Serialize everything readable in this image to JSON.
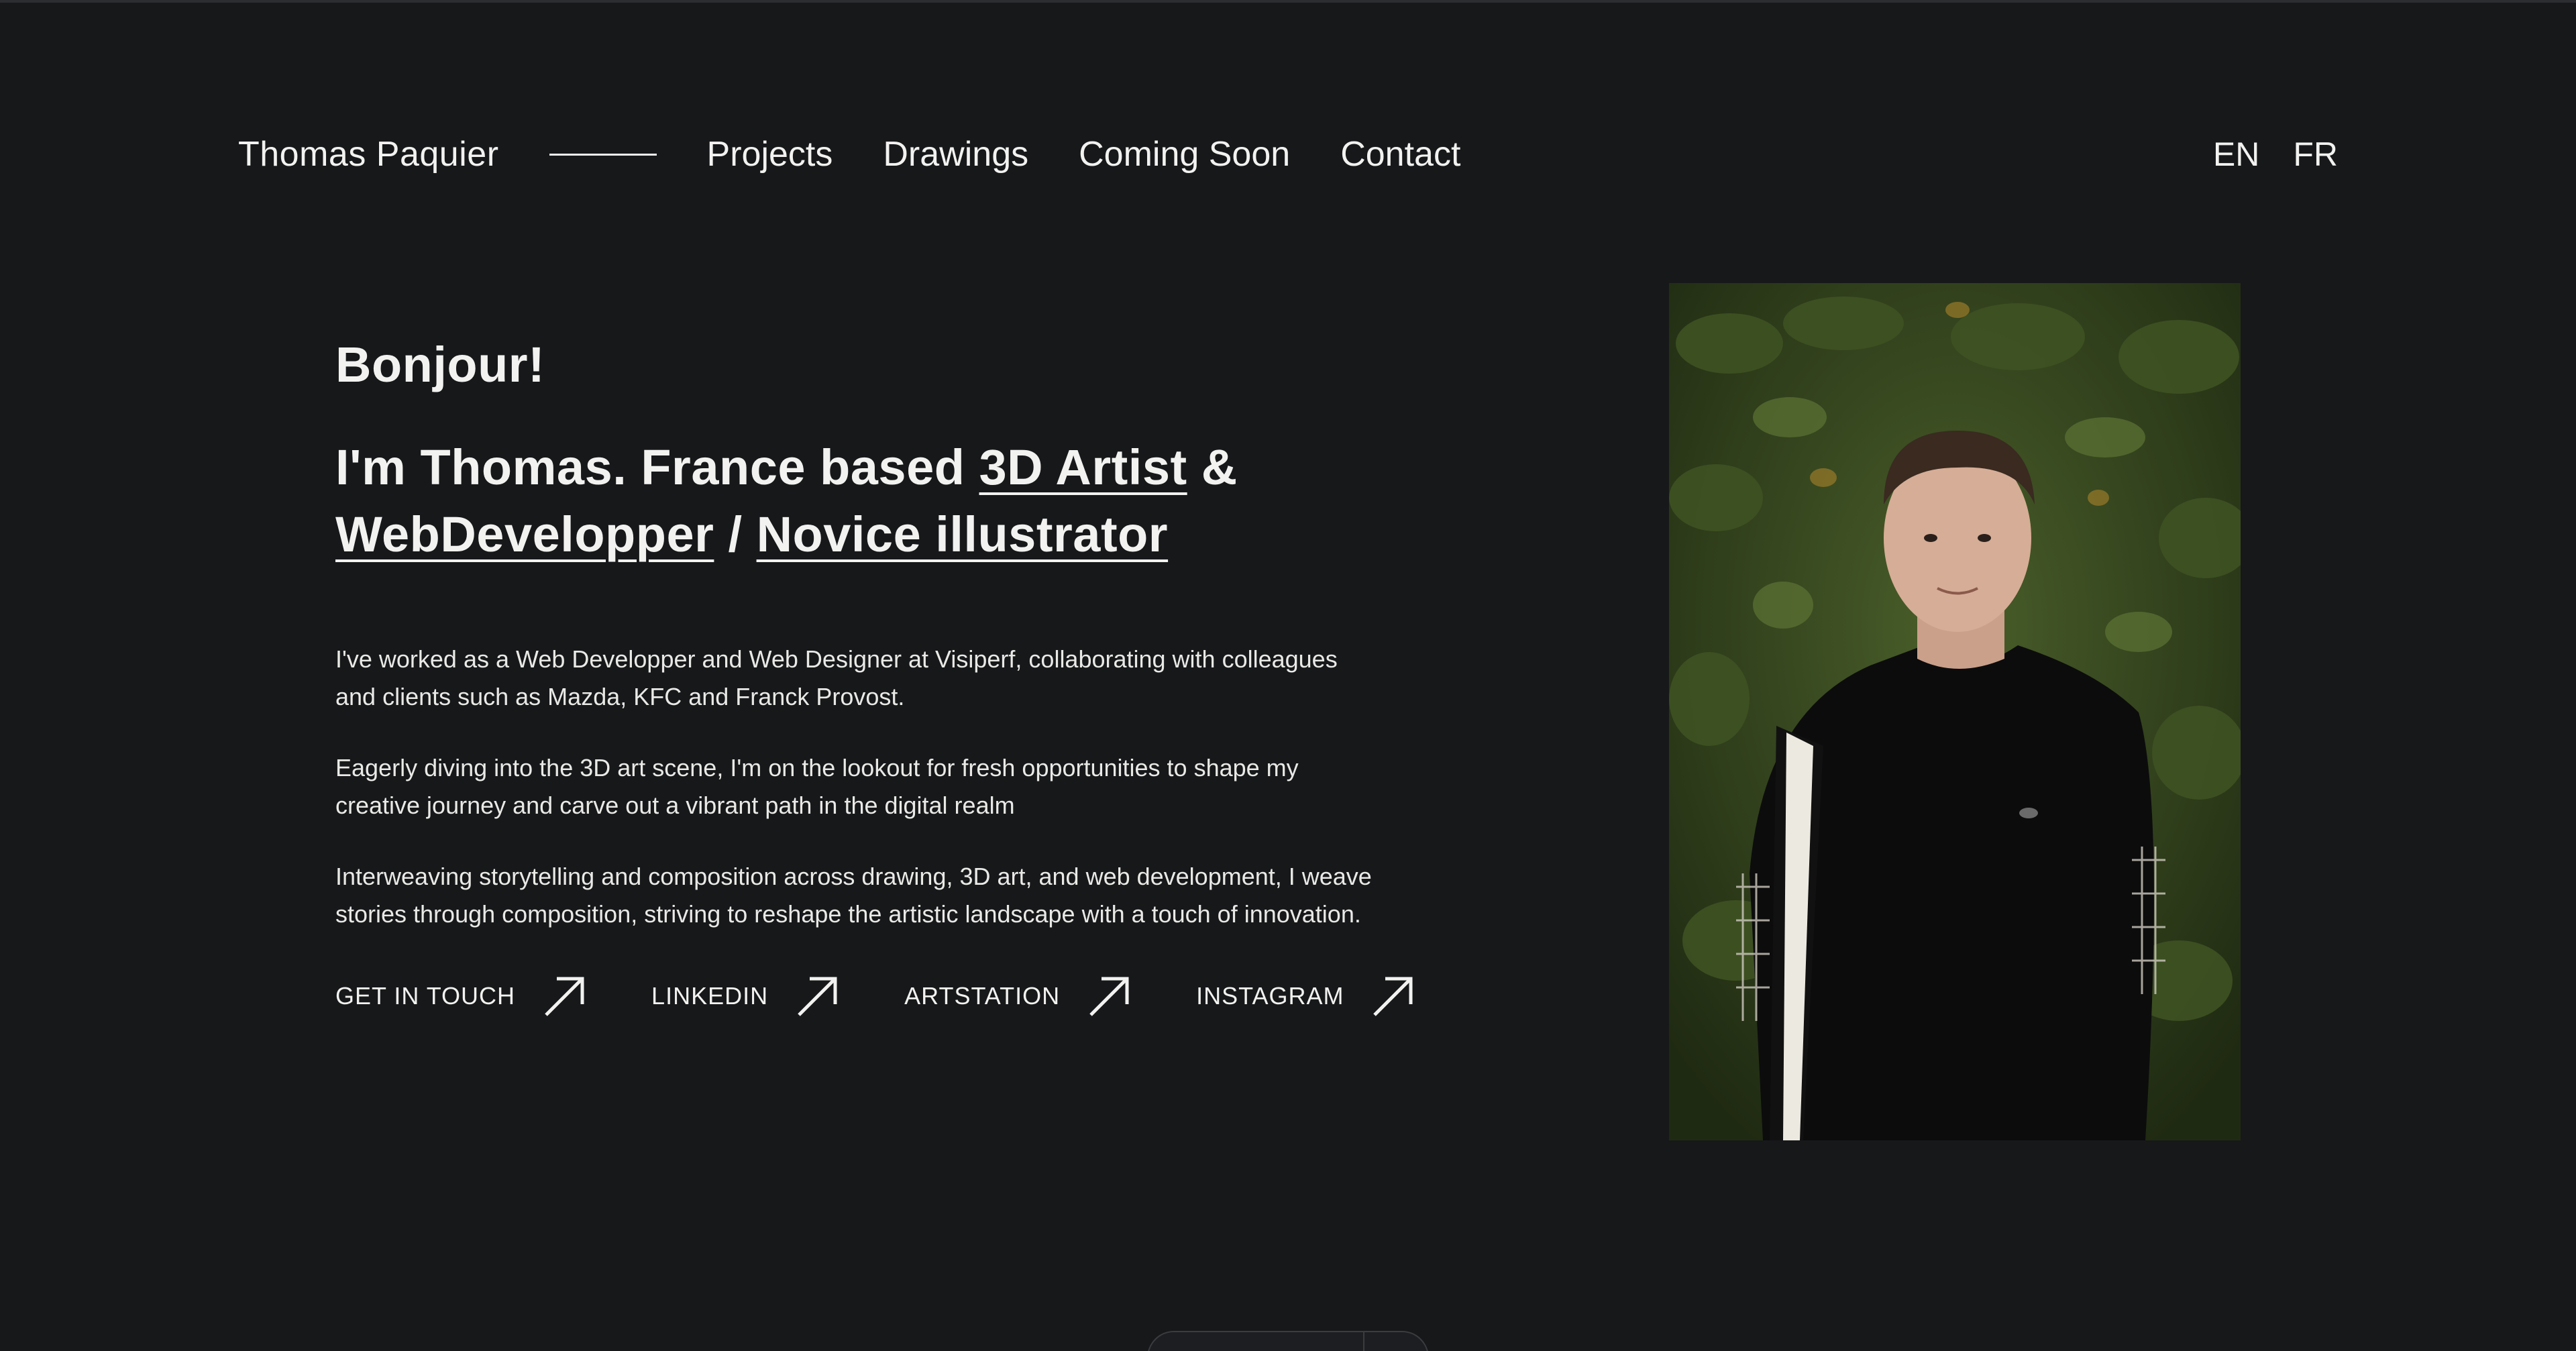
{
  "nav": {
    "brand": "Thomas Paquier",
    "links": [
      "Projects",
      "Drawings",
      "Coming Soon",
      "Contact"
    ],
    "languages": [
      "EN",
      "FR"
    ]
  },
  "intro": {
    "greeting": "Bonjour!",
    "headline_prefix": "I'm Thomas. France based ",
    "role_1": "3D Artist",
    "amp": " &",
    "role_2": "WebDevelopper",
    "slash": " / ",
    "role_3": "Novice illustrator"
  },
  "paragraphs": [
    "I've worked as a Web Developper and Web Designer at Visiperf, collaborating with colleagues and clients such as Mazda, KFC and Franck Provost.",
    "Eagerly diving into the 3D art scene, I'm on the lookout for fresh opportunities to shape my creative journey and carve out a vibrant path in the digital realm",
    "Interweaving storytelling and composition across drawing, 3D art, and web development, I weave stories through composition, striving to reshape the artistic landscape with a touch of innovation."
  ],
  "links": [
    {
      "label": "GET IN TOUCH",
      "icon": "arrow-up-right-icon"
    },
    {
      "label": "LINKEDIN",
      "icon": "arrow-up-right-icon"
    },
    {
      "label": "ARTSTATION",
      "icon": "arrow-up-right-icon"
    },
    {
      "label": "INSTAGRAM",
      "icon": "arrow-up-right-icon"
    }
  ],
  "portrait": {
    "icon": "portrait-photo"
  },
  "colors": {
    "background": "#17181a",
    "text": "#f2f2f0",
    "foliage": "#2c3a1c"
  }
}
